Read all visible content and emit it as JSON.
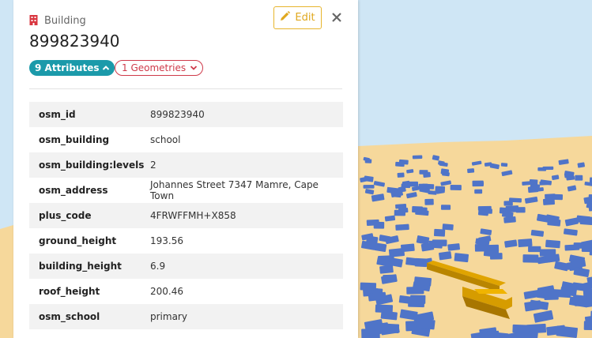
{
  "feature": {
    "type_label": "Building",
    "type_icon": "building-icon",
    "title": "899823940",
    "edit_label": "Edit",
    "edit_icon": "pencil-icon",
    "close_icon": "close-icon"
  },
  "badges": {
    "attributes_label": "9 Attributes",
    "attributes_icon": "chevron-up-icon",
    "geometries_label": "1 Geometries",
    "geometries_icon": "chevron-down-icon"
  },
  "attributes": [
    {
      "key": "osm_id",
      "value": "899823940"
    },
    {
      "key": "osm_building",
      "value": "school"
    },
    {
      "key": "osm_building:levels",
      "value": "2"
    },
    {
      "key": "osm_address",
      "value": "Johannes Street 7347 Mamre, Cape Town"
    },
    {
      "key": "plus_code",
      "value": "4FRWFFMH+X858"
    },
    {
      "key": "ground_height",
      "value": "193.56"
    },
    {
      "key": "building_height",
      "value": "6.9"
    },
    {
      "key": "roof_height",
      "value": "200.46"
    },
    {
      "key": "osm_school",
      "value": "primary"
    }
  ],
  "colors": {
    "accent_teal": "#1b9aaa",
    "accent_red": "#cf3a4a",
    "edit_yellow": "#e0a81e",
    "building_blue": "#4f74c8",
    "selected_building": "#e0a400",
    "terrain": "#f6d89b",
    "sky": "#cfe6f5"
  }
}
